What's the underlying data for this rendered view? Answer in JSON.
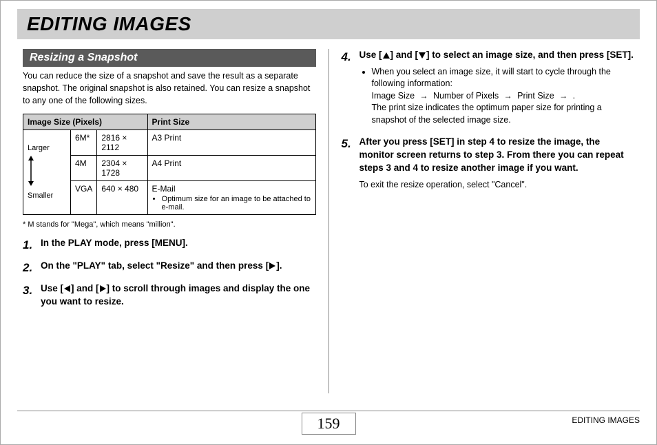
{
  "title": "EDITING IMAGES",
  "section_heading": "Resizing a Snapshot",
  "intro": "You can reduce the size of a snapshot and save the result as a separate snapshot. The original snapshot is also retained. You can resize a snapshot to any one of the following sizes.",
  "table": {
    "head": {
      "c1": "Image Size (Pixels)",
      "c2": "Print Size"
    },
    "scale_top": "Larger",
    "scale_bottom": "Smaller",
    "rows": [
      {
        "size_label": "6M*",
        "pixels": "2816 × 2112",
        "print": "A3 Print"
      },
      {
        "size_label": "4M",
        "pixels": "2304 × 1728",
        "print": "A4 Print"
      },
      {
        "size_label": "VGA",
        "pixels": "640 × 480",
        "print": "E-Mail",
        "print_note": "Optimum size for an image to be attached to e-mail."
      }
    ]
  },
  "footnote": "* M stands for \"Mega\", which means \"million\".",
  "steps_left": [
    {
      "num": "1",
      "main": "In the PLAY mode, press [MENU]."
    },
    {
      "num": "2",
      "main_pre": "On the \"PLAY\" tab, select \"Resize\" and then press [",
      "main_post": "]."
    },
    {
      "num": "3",
      "main_pre": "Use [",
      "main_mid": "] and [",
      "main_post": "] to scroll through images and display the one you want to resize."
    }
  ],
  "steps_right": [
    {
      "num": "4",
      "main_pre": "Use [",
      "main_mid": "] and [",
      "main_post": "] to select an image size, and then press [SET].",
      "bullet1_pre": "When you select an image size, it will start to cycle through the following information:",
      "flow": {
        "a": "Image Size",
        "b": "Number of Pixels",
        "c": "Print Size"
      },
      "bullet1_post": "The print size indicates the optimum paper size for printing a snapshot of the selected image size."
    },
    {
      "num": "5",
      "main": "After you press [SET] in step 4 to resize the image, the monitor screen returns to step 3. From there you can repeat steps 3 and 4 to resize another image if you want.",
      "sub": "To exit the resize operation, select \"Cancel\"."
    }
  ],
  "page_number": "159",
  "footer_label": "EDITING IMAGES"
}
